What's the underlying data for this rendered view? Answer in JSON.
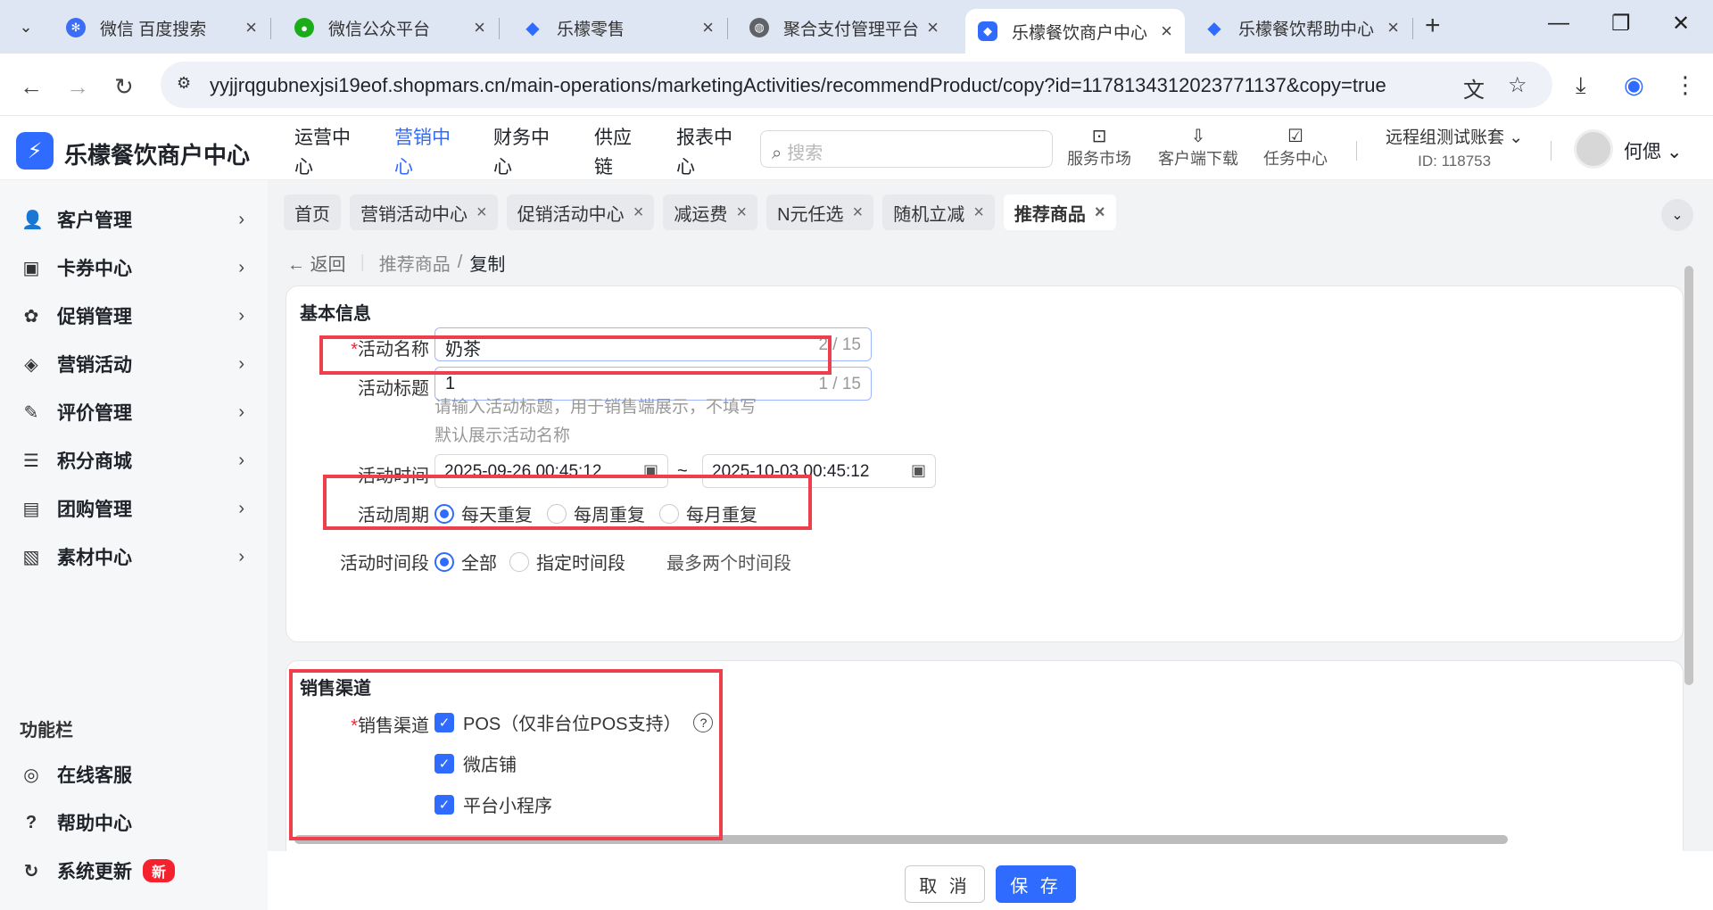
{
  "browser": {
    "tabs": [
      {
        "label": "微信 百度搜索",
        "color": "#3b6ef5"
      },
      {
        "label": "微信公众平台",
        "color": "#1aad19"
      },
      {
        "label": "乐檬零售",
        "color": "#2f6bff"
      },
      {
        "label": "聚合支付管理平台",
        "color": "#5f6368"
      },
      {
        "label": "乐檬餐饮商户中心",
        "color": "#2f6bff"
      },
      {
        "label": "乐檬餐饮帮助中心",
        "color": "#2f6bff"
      }
    ],
    "url": "yyjjrqgubnexjsi19eof.shopmars.cn/main-operations/marketingActivities/recommendProduct/copy?id=1178134312023771137&copy=true"
  },
  "header": {
    "brand": "乐檬餐饮商户中心",
    "nav": [
      {
        "l1": "运营中",
        "l2": "心"
      },
      {
        "l1": "营销中",
        "l2": "心"
      },
      {
        "l1": "财务中",
        "l2": "心"
      },
      {
        "l1": "供应",
        "l2": "链"
      },
      {
        "l1": "报表中",
        "l2": "心"
      }
    ],
    "search_placeholder": "搜索",
    "tools": [
      "服务市场",
      "客户端下载",
      "任务中心"
    ],
    "account_name": "远程组测试账套",
    "account_id": "ID: 118753",
    "user": "何偲"
  },
  "sidebar": {
    "items": [
      {
        "label": "客户管理",
        "icon": "user-icon"
      },
      {
        "label": "卡券中心",
        "icon": "card-icon"
      },
      {
        "label": "促销管理",
        "icon": "promo-icon"
      },
      {
        "label": "营销活动",
        "icon": "tag-icon"
      },
      {
        "label": "评价管理",
        "icon": "edit-icon"
      },
      {
        "label": "积分商城",
        "icon": "coins-icon"
      },
      {
        "label": "团购管理",
        "icon": "gift-icon"
      },
      {
        "label": "素材中心",
        "icon": "image-icon"
      }
    ],
    "func_title": "功能栏",
    "func_items": [
      {
        "label": "在线客服",
        "icon": "headset-icon"
      },
      {
        "label": "帮助中心",
        "icon": "help-icon"
      },
      {
        "label": "系统更新",
        "icon": "refresh-icon"
      }
    ],
    "new_badge": "新"
  },
  "tags": [
    "首页",
    "营销活动中心",
    "促销活动中心",
    "减运费",
    "N元任选",
    "随机立减",
    "推荐商品"
  ],
  "breadcrumb": {
    "back": "返回",
    "parent": "推荐商品",
    "sep": "/",
    "current": "复制"
  },
  "basic": {
    "title": "基本信息",
    "name_label": "活动名称",
    "name_value": "奶茶",
    "name_count": "2 / 15",
    "title_label": "活动标题",
    "title_value": "1",
    "title_count": "1 / 15",
    "title_hint_1": "请输入活动标题，用于销售端展示，不填写",
    "title_hint_2": "默认展示活动名称",
    "time_label": "活动时间",
    "start": "2025-09-26 00:45:12",
    "end": "2025-10-03 00:45:12",
    "tilde": "~",
    "cycle_label": "活动周期",
    "cycle_options": [
      "每天重复",
      "每周重复",
      "每月重复"
    ],
    "cycle_selected": "每天重复",
    "period_label": "活动时间段",
    "period_options": [
      "全部",
      "指定时间段"
    ],
    "period_selected": "全部",
    "period_note": "最多两个时间段"
  },
  "channels": {
    "title": "销售渠道",
    "label": "销售渠道",
    "options": [
      "POS（仅非台位POS支持）",
      "微店铺",
      "平台小程序"
    ],
    "checked": [
      true,
      true,
      true
    ]
  },
  "footer": {
    "cancel": "取 消",
    "save": "保 存"
  },
  "colors": {
    "primary": "#2f6bff",
    "highlight": "#ee3f4d",
    "danger": "#f5222d"
  }
}
